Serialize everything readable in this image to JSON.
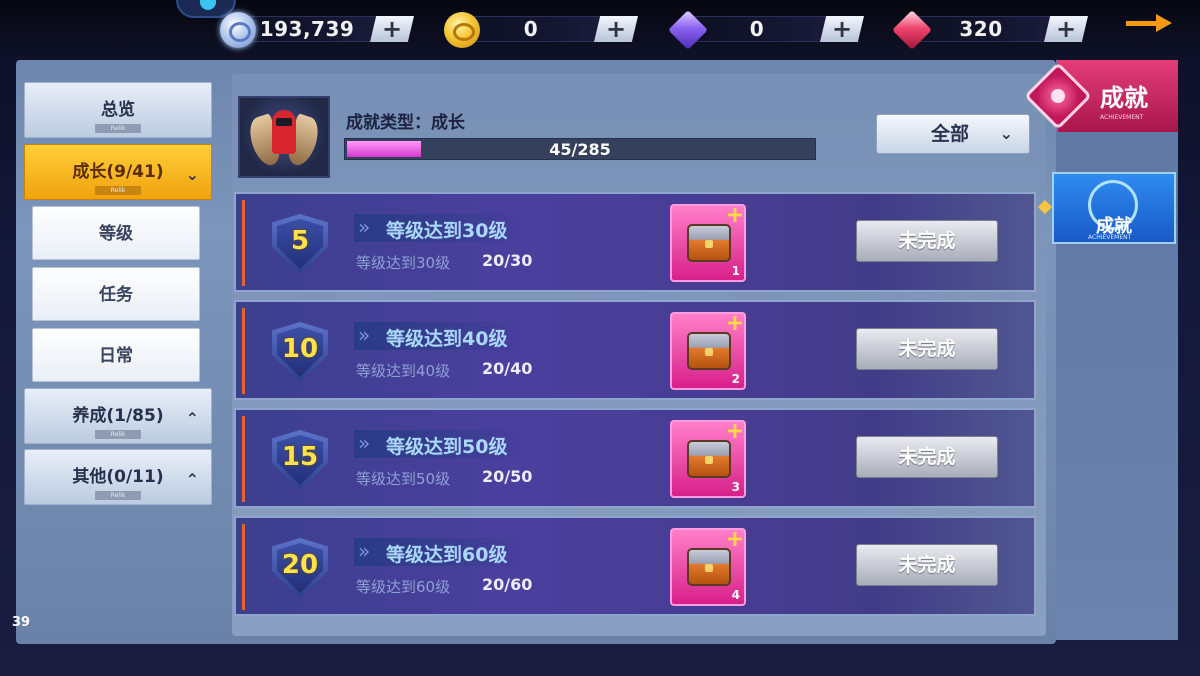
{
  "currencies": [
    {
      "name": "silver-coin",
      "amount": "193,739",
      "plus": "+"
    },
    {
      "name": "gold-coin",
      "amount": "0",
      "plus": "+"
    },
    {
      "name": "purple-gem",
      "amount": "0",
      "plus": "+"
    },
    {
      "name": "red-gem",
      "amount": "320",
      "plus": "+"
    }
  ],
  "sidebar": {
    "overview": {
      "label": "总览",
      "sub": "Relik"
    },
    "growth": {
      "label": "成长(9/41)",
      "sub": "Relik"
    },
    "growth_children": [
      "等级",
      "任务",
      "日常"
    ],
    "nurture": {
      "label": "养成(1/85)",
      "sub": "Relik"
    },
    "other": {
      "label": "其他(0/11)",
      "sub": "Relik"
    }
  },
  "header": {
    "type_label": "成就类型：成长",
    "progress_text": "45/285",
    "progress_value": 45,
    "progress_max": 285,
    "filter_label": "全部"
  },
  "achievements": [
    {
      "level": "5",
      "title": "等级达到30级",
      "desc": "等级达到30级",
      "count": "20/30",
      "reward_qty": "1",
      "status": "未完成"
    },
    {
      "level": "10",
      "title": "等级达到40级",
      "desc": "等级达到40级",
      "count": "20/40",
      "reward_qty": "2",
      "status": "未完成"
    },
    {
      "level": "15",
      "title": "等级达到50级",
      "desc": "等级达到50级",
      "count": "20/50",
      "reward_qty": "3",
      "status": "未完成"
    },
    {
      "level": "20",
      "title": "等级达到60级",
      "desc": "等级达到60级",
      "count": "20/60",
      "reward_qty": "4",
      "status": "未完成"
    }
  ],
  "side_tabs": {
    "top": {
      "label": "成就",
      "sub": "ACHIEVEMENT"
    },
    "active": {
      "label": "成就",
      "sub": "ACHIEVEMENT"
    }
  },
  "page_number": "39",
  "colors": {
    "accent_gold": "#f0a20e",
    "progress_pink": "#d33bd0",
    "row_purple": "#463c8f",
    "tab_blue": "#1959c7",
    "tab_pink": "#a8174a"
  }
}
